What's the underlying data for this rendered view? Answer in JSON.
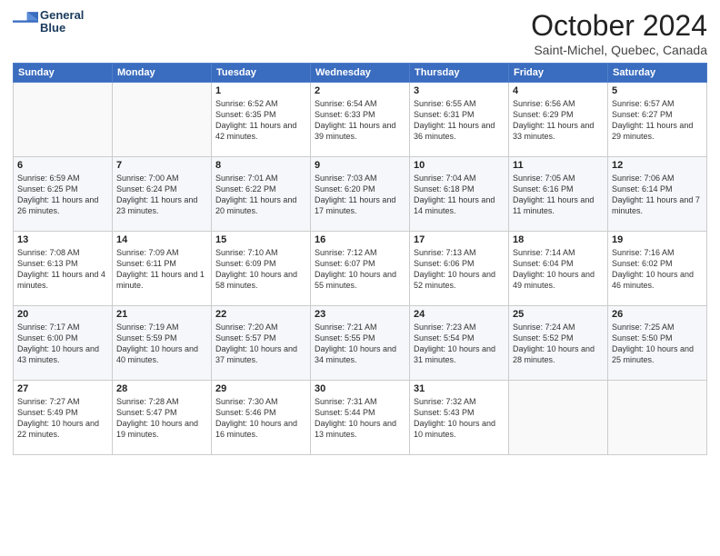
{
  "logo": {
    "line1": "General",
    "line2": "Blue"
  },
  "header": {
    "month": "October 2024",
    "location": "Saint-Michel, Quebec, Canada"
  },
  "weekdays": [
    "Sunday",
    "Monday",
    "Tuesday",
    "Wednesday",
    "Thursday",
    "Friday",
    "Saturday"
  ],
  "weeks": [
    [
      {
        "day": "",
        "info": ""
      },
      {
        "day": "",
        "info": ""
      },
      {
        "day": "1",
        "info": "Sunrise: 6:52 AM\nSunset: 6:35 PM\nDaylight: 11 hours and 42 minutes."
      },
      {
        "day": "2",
        "info": "Sunrise: 6:54 AM\nSunset: 6:33 PM\nDaylight: 11 hours and 39 minutes."
      },
      {
        "day": "3",
        "info": "Sunrise: 6:55 AM\nSunset: 6:31 PM\nDaylight: 11 hours and 36 minutes."
      },
      {
        "day": "4",
        "info": "Sunrise: 6:56 AM\nSunset: 6:29 PM\nDaylight: 11 hours and 33 minutes."
      },
      {
        "day": "5",
        "info": "Sunrise: 6:57 AM\nSunset: 6:27 PM\nDaylight: 11 hours and 29 minutes."
      }
    ],
    [
      {
        "day": "6",
        "info": "Sunrise: 6:59 AM\nSunset: 6:25 PM\nDaylight: 11 hours and 26 minutes."
      },
      {
        "day": "7",
        "info": "Sunrise: 7:00 AM\nSunset: 6:24 PM\nDaylight: 11 hours and 23 minutes."
      },
      {
        "day": "8",
        "info": "Sunrise: 7:01 AM\nSunset: 6:22 PM\nDaylight: 11 hours and 20 minutes."
      },
      {
        "day": "9",
        "info": "Sunrise: 7:03 AM\nSunset: 6:20 PM\nDaylight: 11 hours and 17 minutes."
      },
      {
        "day": "10",
        "info": "Sunrise: 7:04 AM\nSunset: 6:18 PM\nDaylight: 11 hours and 14 minutes."
      },
      {
        "day": "11",
        "info": "Sunrise: 7:05 AM\nSunset: 6:16 PM\nDaylight: 11 hours and 11 minutes."
      },
      {
        "day": "12",
        "info": "Sunrise: 7:06 AM\nSunset: 6:14 PM\nDaylight: 11 hours and 7 minutes."
      }
    ],
    [
      {
        "day": "13",
        "info": "Sunrise: 7:08 AM\nSunset: 6:13 PM\nDaylight: 11 hours and 4 minutes."
      },
      {
        "day": "14",
        "info": "Sunrise: 7:09 AM\nSunset: 6:11 PM\nDaylight: 11 hours and 1 minute."
      },
      {
        "day": "15",
        "info": "Sunrise: 7:10 AM\nSunset: 6:09 PM\nDaylight: 10 hours and 58 minutes."
      },
      {
        "day": "16",
        "info": "Sunrise: 7:12 AM\nSunset: 6:07 PM\nDaylight: 10 hours and 55 minutes."
      },
      {
        "day": "17",
        "info": "Sunrise: 7:13 AM\nSunset: 6:06 PM\nDaylight: 10 hours and 52 minutes."
      },
      {
        "day": "18",
        "info": "Sunrise: 7:14 AM\nSunset: 6:04 PM\nDaylight: 10 hours and 49 minutes."
      },
      {
        "day": "19",
        "info": "Sunrise: 7:16 AM\nSunset: 6:02 PM\nDaylight: 10 hours and 46 minutes."
      }
    ],
    [
      {
        "day": "20",
        "info": "Sunrise: 7:17 AM\nSunset: 6:00 PM\nDaylight: 10 hours and 43 minutes."
      },
      {
        "day": "21",
        "info": "Sunrise: 7:19 AM\nSunset: 5:59 PM\nDaylight: 10 hours and 40 minutes."
      },
      {
        "day": "22",
        "info": "Sunrise: 7:20 AM\nSunset: 5:57 PM\nDaylight: 10 hours and 37 minutes."
      },
      {
        "day": "23",
        "info": "Sunrise: 7:21 AM\nSunset: 5:55 PM\nDaylight: 10 hours and 34 minutes."
      },
      {
        "day": "24",
        "info": "Sunrise: 7:23 AM\nSunset: 5:54 PM\nDaylight: 10 hours and 31 minutes."
      },
      {
        "day": "25",
        "info": "Sunrise: 7:24 AM\nSunset: 5:52 PM\nDaylight: 10 hours and 28 minutes."
      },
      {
        "day": "26",
        "info": "Sunrise: 7:25 AM\nSunset: 5:50 PM\nDaylight: 10 hours and 25 minutes."
      }
    ],
    [
      {
        "day": "27",
        "info": "Sunrise: 7:27 AM\nSunset: 5:49 PM\nDaylight: 10 hours and 22 minutes."
      },
      {
        "day": "28",
        "info": "Sunrise: 7:28 AM\nSunset: 5:47 PM\nDaylight: 10 hours and 19 minutes."
      },
      {
        "day": "29",
        "info": "Sunrise: 7:30 AM\nSunset: 5:46 PM\nDaylight: 10 hours and 16 minutes."
      },
      {
        "day": "30",
        "info": "Sunrise: 7:31 AM\nSunset: 5:44 PM\nDaylight: 10 hours and 13 minutes."
      },
      {
        "day": "31",
        "info": "Sunrise: 7:32 AM\nSunset: 5:43 PM\nDaylight: 10 hours and 10 minutes."
      },
      {
        "day": "",
        "info": ""
      },
      {
        "day": "",
        "info": ""
      }
    ]
  ]
}
